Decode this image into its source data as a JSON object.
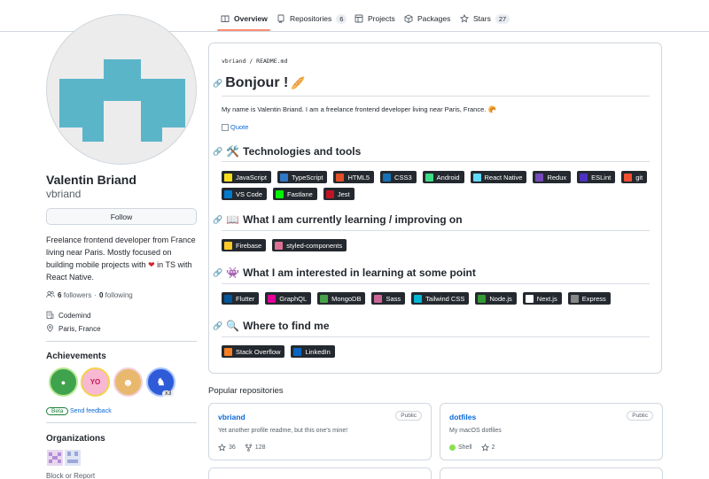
{
  "nav": {
    "tabs": [
      {
        "label": "Overview",
        "icon": "book-icon"
      },
      {
        "label": "Repositories",
        "icon": "repo-icon",
        "count": "6"
      },
      {
        "label": "Projects",
        "icon": "table-icon"
      },
      {
        "label": "Packages",
        "icon": "package-icon"
      },
      {
        "label": "Stars",
        "icon": "star-icon",
        "count": "27"
      }
    ]
  },
  "profile": {
    "name": "Valentin Briand",
    "login": "vbriand",
    "follow_label": "Follow",
    "bio": "Freelance frontend developer from France living near Paris. Mostly focused on building mobile projects with",
    "bio_end": "in TS with React Native.",
    "followers_count": "6",
    "followers_label": "followers",
    "following_count": "0",
    "following_label": "following",
    "separator": "·",
    "company": "Codemind",
    "location": "Paris, France"
  },
  "achievements": {
    "title": "Achievements",
    "extra_count": "x3",
    "beta_label": "Beta",
    "feedback_label": "Send feedback"
  },
  "organizations": {
    "title": "Organizations",
    "block_label": "Block or Report"
  },
  "readme": {
    "path_user": "vbriand",
    "path_sep": " / ",
    "path_file": "README.md",
    "heading": "Bonjour !",
    "intro": "My name is Valentin Briand. I am a freelance frontend developer living near Paris, France.",
    "quote_alt": "Quote",
    "sections": [
      {
        "title": "Technologies and tools",
        "emoji": "🛠️"
      },
      {
        "title": "What I am currently learning / improving on",
        "emoji": "📖"
      },
      {
        "title": "What I am interested in learning at some point",
        "emoji": "👾"
      },
      {
        "title": "Where to find me",
        "emoji": "🔍"
      }
    ],
    "badges_tech": [
      {
        "label": "JavaScript",
        "color": "#f7df1e"
      },
      {
        "label": "TypeScript",
        "color": "#3178c6"
      },
      {
        "label": "HTML5",
        "color": "#e34f26"
      },
      {
        "label": "CSS3",
        "color": "#1572b6"
      },
      {
        "label": "Android",
        "color": "#3ddc84"
      },
      {
        "label": "React Native",
        "color": "#61dafb"
      },
      {
        "label": "Redux",
        "color": "#764abc"
      },
      {
        "label": "ESLint",
        "color": "#4b32c3"
      },
      {
        "label": "git",
        "color": "#f05032"
      },
      {
        "label": "VS Code",
        "color": "#007acc"
      },
      {
        "label": "Fastlane",
        "color": "#00f200"
      },
      {
        "label": "Jest",
        "color": "#c21325"
      }
    ],
    "badges_learning": [
      {
        "label": "Firebase",
        "color": "#ffca28"
      },
      {
        "label": "styled-components",
        "color": "#db7093"
      }
    ],
    "badges_interested": [
      {
        "label": "Flutter",
        "color": "#02569b"
      },
      {
        "label": "GraphQL",
        "color": "#e10098"
      },
      {
        "label": "MongoDB",
        "color": "#47a248"
      },
      {
        "label": "Sass",
        "color": "#cc6699"
      },
      {
        "label": "Tailwind CSS",
        "color": "#06b6d4"
      },
      {
        "label": "Node.js",
        "color": "#339933"
      },
      {
        "label": "Next.js",
        "color": "#ffffff"
      },
      {
        "label": "Express",
        "color": "#888888"
      }
    ],
    "badges_find": [
      {
        "label": "Stack Overflow",
        "color": "#f58025"
      },
      {
        "label": "LinkedIn",
        "color": "#0a66c2"
      }
    ]
  },
  "popular": {
    "title": "Popular repositories",
    "repos": [
      {
        "name": "vbriand",
        "visibility": "Public",
        "description": "Yet another profile readme, but this one's mine!",
        "stars": "36",
        "forks": "128"
      },
      {
        "name": "dotfiles",
        "visibility": "Public",
        "description": "My macOS dotfiles",
        "language": "Shell",
        "language_color": "#89e051",
        "stars": "2"
      }
    ]
  }
}
